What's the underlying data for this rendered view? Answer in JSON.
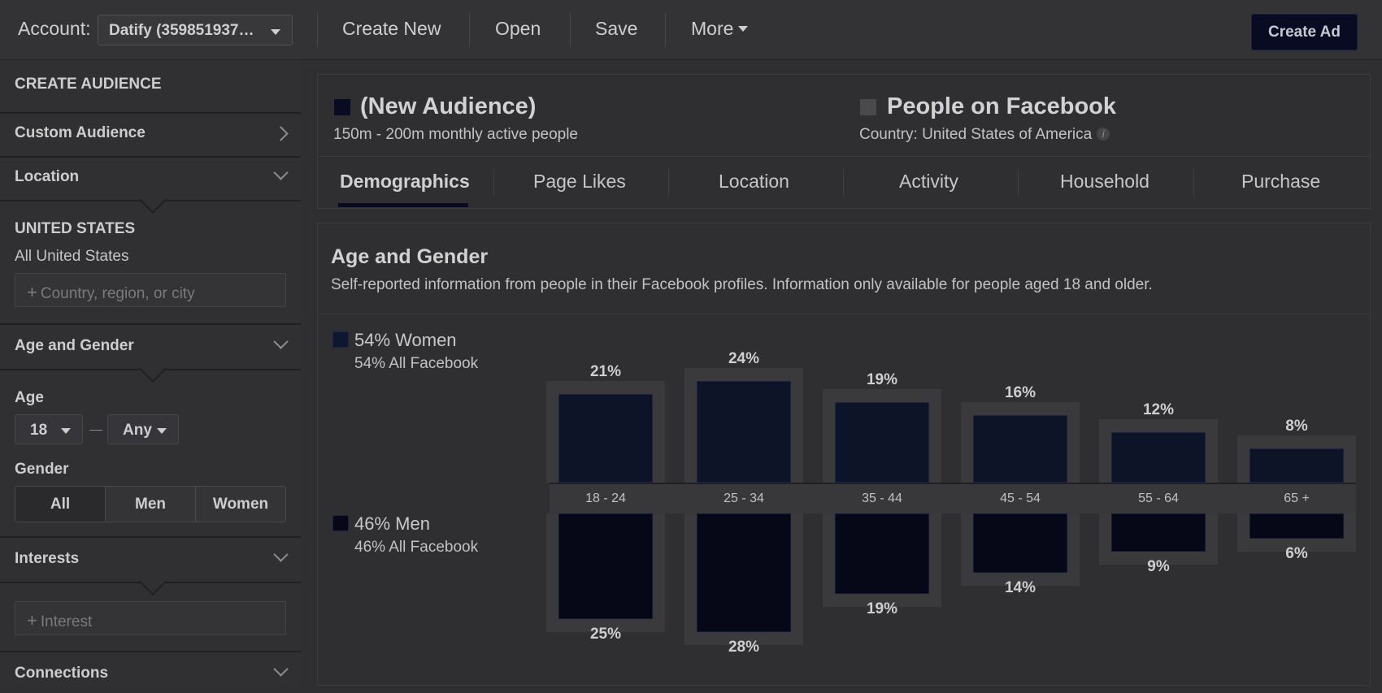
{
  "toolbar": {
    "account_label": "Account:",
    "account_value": "Datify (359851937…",
    "create_new": "Create New",
    "open": "Open",
    "save": "Save",
    "more": "More",
    "create_ad": "Create Ad"
  },
  "sidebar": {
    "header": "CREATE AUDIENCE",
    "custom_audience": "Custom Audience",
    "location": "Location",
    "country_heading": "UNITED STATES",
    "country_detail": "All United States",
    "location_placeholder": "Country, region, or city",
    "age_gender": "Age and Gender",
    "age_label": "Age",
    "age_min": "18",
    "age_max": "Any",
    "gender_label": "Gender",
    "gender_options": [
      "All",
      "Men",
      "Women"
    ],
    "gender_selected": "All",
    "interests": "Interests",
    "interest_placeholder": "Interest",
    "connections": "Connections"
  },
  "audience": {
    "title": "(New Audience)",
    "size": "150m - 200m monthly active people",
    "compare_title": "People on Facebook",
    "compare_detail": "Country: United States of America"
  },
  "tabs": [
    "Demographics",
    "Page Likes",
    "Location",
    "Activity",
    "Household",
    "Purchase"
  ],
  "active_tab": "Demographics",
  "section": {
    "title": "Age and Gender",
    "description": "Self-reported information from people in their Facebook profiles. Information only available for people aged 18 and older."
  },
  "legend": {
    "women_main": "54% Women",
    "women_sub": "54% All Facebook",
    "men_main": "46% Men",
    "men_sub": "46% All Facebook"
  },
  "colors": {
    "audience_swatch": "#080b22",
    "facebook_swatch": "#4a4a4d",
    "women_bar": "#0d1428",
    "men_bar": "#060818"
  },
  "chart_data": {
    "type": "bar",
    "categories": [
      "18 - 24",
      "25 - 34",
      "35 - 44",
      "45 - 54",
      "55 - 64",
      "65 +"
    ],
    "series": [
      {
        "name": "Women",
        "values": [
          21,
          24,
          19,
          16,
          12,
          8
        ],
        "labels": [
          "21%",
          "24%",
          "19%",
          "16%",
          "12%",
          "8%"
        ]
      },
      {
        "name": "Men",
        "values": [
          25,
          28,
          19,
          14,
          9,
          6
        ],
        "labels": [
          "25%",
          "28%",
          "19%",
          "14%",
          "9%",
          "6%"
        ]
      }
    ],
    "unit": "%"
  }
}
